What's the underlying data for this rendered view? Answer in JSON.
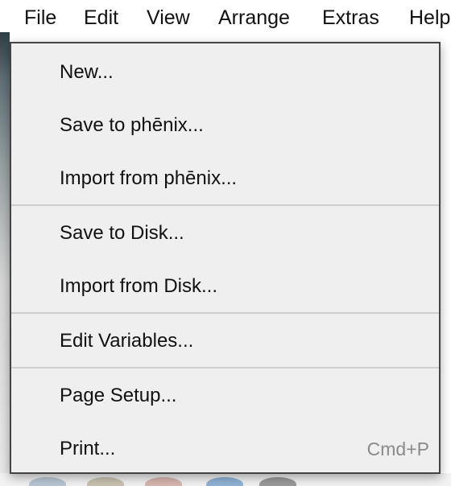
{
  "menubar": {
    "items": [
      "File",
      "Edit",
      "View",
      "Arrange",
      "Extras",
      "Help"
    ]
  },
  "file_menu": {
    "items": [
      {
        "label": "New...",
        "shortcut": ""
      },
      {
        "label": "Save to phēnix...",
        "shortcut": ""
      },
      {
        "label": "Import from phēnix...",
        "shortcut": ""
      },
      {
        "label": "Save to Disk...",
        "shortcut": ""
      },
      {
        "label": "Import from Disk...",
        "shortcut": ""
      },
      {
        "label": "Edit Variables...",
        "shortcut": ""
      },
      {
        "label": "Page Setup...",
        "shortcut": ""
      },
      {
        "label": "Print...",
        "shortcut": "Cmd+P"
      }
    ]
  },
  "colors": {
    "menu_bg": "#efefef",
    "menu_border": "#444444",
    "separator": "#cfcfcf",
    "shortcut_text": "#8a8a8a"
  }
}
